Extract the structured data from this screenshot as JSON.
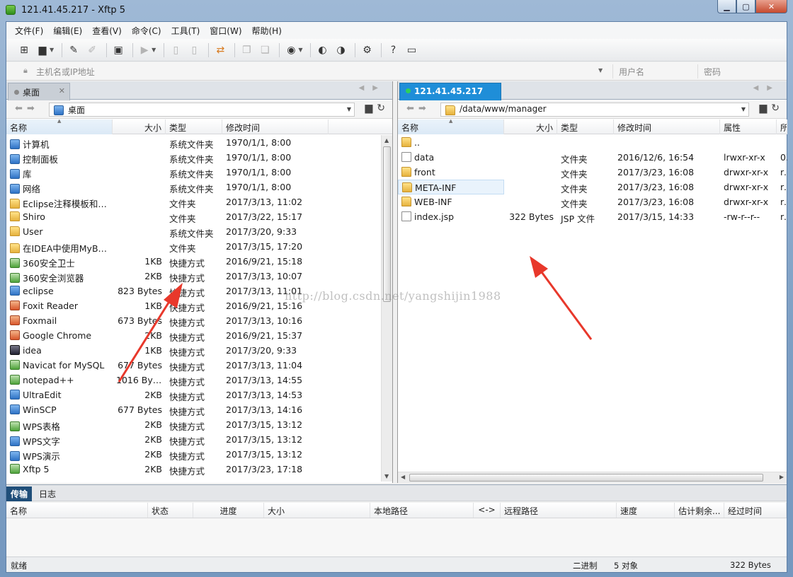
{
  "window": {
    "title": "121.41.45.217    - Xftp 5",
    "buttons": {
      "minimize": "▁",
      "maximize": "▢",
      "close": "✕"
    }
  },
  "menu": [
    "文件(F)",
    "编辑(E)",
    "查看(V)",
    "命令(C)",
    "工具(T)",
    "窗口(W)",
    "帮助(H)"
  ],
  "address": {
    "host_placeholder": "主机名或IP地址",
    "user_placeholder": "用户名",
    "password_placeholder": "密码"
  },
  "left_pane": {
    "tab_label": "桌面",
    "path": "桌面",
    "columns": [
      "名称",
      "大小",
      "类型",
      "修改时间"
    ],
    "rows": [
      {
        "icon": "sys",
        "name": "计算机",
        "size": "",
        "type": "系统文件夹",
        "modified": "1970/1/1, 8:00"
      },
      {
        "icon": "sys",
        "name": "控制面板",
        "size": "",
        "type": "系统文件夹",
        "modified": "1970/1/1, 8:00"
      },
      {
        "icon": "sys",
        "name": "库",
        "size": "",
        "type": "系统文件夹",
        "modified": "1970/1/1, 8:00"
      },
      {
        "icon": "sys",
        "name": "网络",
        "size": "",
        "type": "系统文件夹",
        "modified": "1970/1/1, 8:00"
      },
      {
        "icon": "folder",
        "name": "Eclipse注释模板和格...",
        "size": "",
        "type": "文件夹",
        "modified": "2017/3/13, 11:02"
      },
      {
        "icon": "folder",
        "name": "Shiro",
        "size": "",
        "type": "文件夹",
        "modified": "2017/3/22, 15:17"
      },
      {
        "icon": "folder",
        "name": "User",
        "size": "",
        "type": "系统文件夹",
        "modified": "2017/3/20, 9:33"
      },
      {
        "icon": "folder",
        "name": "在IDEA中使用MyBat...",
        "size": "",
        "type": "文件夹",
        "modified": "2017/3/15, 17:20"
      },
      {
        "icon": "link",
        "name": "360安全卫士",
        "size": "1KB",
        "type": "快捷方式",
        "modified": "2016/9/21, 15:18"
      },
      {
        "icon": "link",
        "name": "360安全浏览器",
        "size": "2KB",
        "type": "快捷方式",
        "modified": "2017/3/13, 10:07"
      },
      {
        "icon": "sys",
        "name": "eclipse",
        "size": "823 Bytes",
        "type": "快捷方式",
        "modified": "2017/3/13, 11:01"
      },
      {
        "icon": "app",
        "name": "Foxit Reader",
        "size": "1KB",
        "type": "快捷方式",
        "modified": "2016/9/21, 15:16"
      },
      {
        "icon": "app",
        "name": "Foxmail",
        "size": "673 Bytes",
        "type": "快捷方式",
        "modified": "2017/3/13, 10:16"
      },
      {
        "icon": "app",
        "name": "Google Chrome",
        "size": "2KB",
        "type": "快捷方式",
        "modified": "2016/9/21, 15:37"
      },
      {
        "icon": "dark",
        "name": "idea",
        "size": "1KB",
        "type": "快捷方式",
        "modified": "2017/3/20, 9:33"
      },
      {
        "icon": "link",
        "name": "Navicat for MySQL",
        "size": "677 Bytes",
        "type": "快捷方式",
        "modified": "2017/3/13, 11:04"
      },
      {
        "icon": "link",
        "name": "notepad++",
        "size": "1016 Byt...",
        "type": "快捷方式",
        "modified": "2017/3/13, 14:55"
      },
      {
        "icon": "sys",
        "name": "UltraEdit",
        "size": "2KB",
        "type": "快捷方式",
        "modified": "2017/3/13, 14:53"
      },
      {
        "icon": "sys",
        "name": "WinSCP",
        "size": "677 Bytes",
        "type": "快捷方式",
        "modified": "2017/3/13, 14:16"
      },
      {
        "icon": "link",
        "name": "WPS表格",
        "size": "2KB",
        "type": "快捷方式",
        "modified": "2017/3/15, 13:12"
      },
      {
        "icon": "sys",
        "name": "WPS文字",
        "size": "2KB",
        "type": "快捷方式",
        "modified": "2017/3/15, 13:12"
      },
      {
        "icon": "sys",
        "name": "WPS演示",
        "size": "2KB",
        "type": "快捷方式",
        "modified": "2017/3/15, 13:12"
      },
      {
        "icon": "link",
        "name": "Xftp 5",
        "size": "2KB",
        "type": "快捷方式",
        "modified": "2017/3/23, 17:18"
      }
    ]
  },
  "right_pane": {
    "tab_label": "121.41.45.217",
    "path": "/data/www/manager",
    "columns": [
      "名称",
      "大小",
      "类型",
      "修改时间",
      "属性",
      "所"
    ],
    "rows": [
      {
        "icon": "folder",
        "name": "..",
        "size": "",
        "type": "",
        "modified": "",
        "attr": "",
        "owner": ""
      },
      {
        "icon": "file",
        "name": "data",
        "size": "",
        "type": "文件夹",
        "modified": "2016/12/6, 16:54",
        "attr": "lrwxr-xr-x",
        "owner": "0"
      },
      {
        "icon": "folder",
        "name": "front",
        "size": "",
        "type": "文件夹",
        "modified": "2017/3/23, 16:08",
        "attr": "drwxr-xr-x",
        "owner": "rc"
      },
      {
        "icon": "folder",
        "name": "META-INF",
        "size": "",
        "type": "文件夹",
        "modified": "2017/3/23, 16:08",
        "attr": "drwxr-xr-x",
        "owner": "rc"
      },
      {
        "icon": "folder",
        "name": "WEB-INF",
        "size": "",
        "type": "文件夹",
        "modified": "2017/3/23, 16:08",
        "attr": "drwxr-xr-x",
        "owner": "rc"
      },
      {
        "icon": "file",
        "name": "index.jsp",
        "size": "322 Bytes",
        "type": "JSP 文件",
        "modified": "2017/3/15, 14:33",
        "attr": "-rw-r--r--",
        "owner": "rc"
      }
    ]
  },
  "watermark": "http://blog.csdn.net/yangshijin1988",
  "transfer": {
    "tabs": [
      "传输",
      "日志"
    ],
    "columns": [
      "名称",
      "状态",
      "进度",
      "大小",
      "本地路径",
      "<->",
      "远程路径",
      "速度",
      "估计剩余...",
      "经过时间"
    ]
  },
  "status": {
    "ready": "就绪",
    "mode": "二进制",
    "objects": "5 对象",
    "size": "322 Bytes"
  },
  "colors": {
    "active_tab": "#1f8ed8",
    "arrow": "#e8382b"
  }
}
